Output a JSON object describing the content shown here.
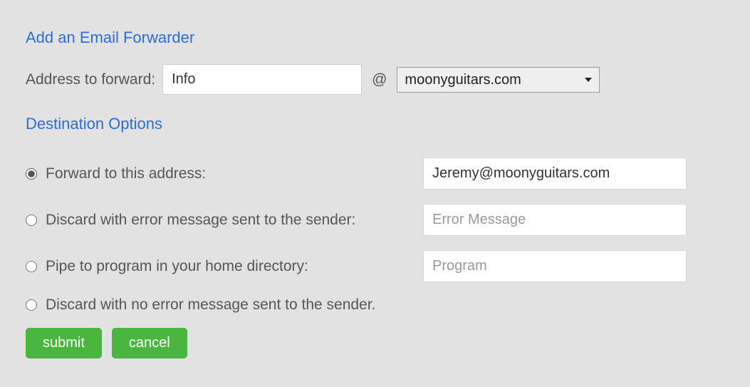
{
  "headings": {
    "main": "Add an Email Forwarder",
    "destination": "Destination Options"
  },
  "address": {
    "label": "Address to forward:",
    "value": "Info",
    "at": "@",
    "domain_selected": "moonyguitars.com"
  },
  "options": {
    "forward": {
      "label": "Forward to this address:",
      "value": "Jeremy@moonyguitars.com"
    },
    "discard_error": {
      "label": "Discard with error message sent to the sender:",
      "placeholder": "Error Message"
    },
    "pipe": {
      "label": "Pipe to program in your home directory:",
      "placeholder": "Program"
    },
    "discard_silent": {
      "label": "Discard with no error message sent to the sender."
    }
  },
  "buttons": {
    "submit": "submit",
    "cancel": "cancel"
  }
}
